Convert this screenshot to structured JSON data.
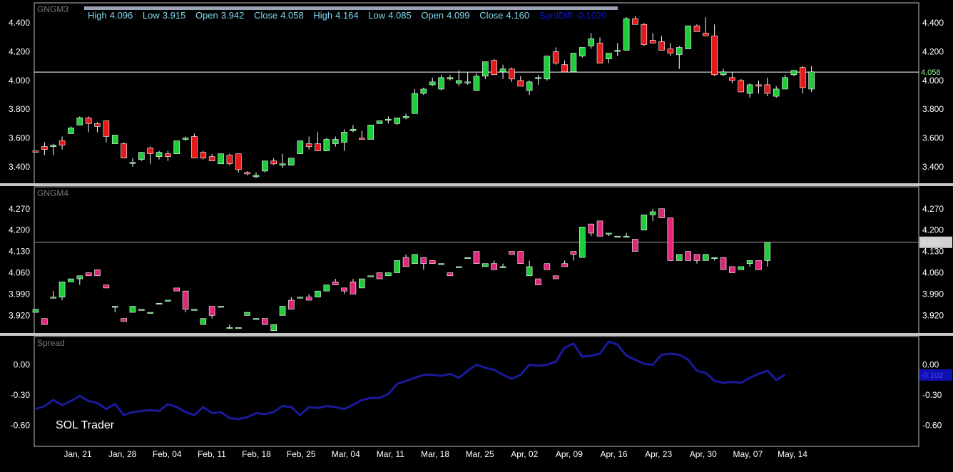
{
  "info_bar": {
    "high_label": "High",
    "high_value": "4.096",
    "low_label": "Low",
    "low_value": "3.915",
    "open_label": "Open",
    "open_value": "3.942",
    "close_label": "Close",
    "close_value": "4.058",
    "high2_label": "High",
    "high2_value": "4.164",
    "low2_label": "Low",
    "low2_value": "4.085",
    "open2_label": "Open",
    "open2_value": "4.099",
    "close2_label": "Close",
    "close2_value": "4.160",
    "spread_label": "SprdDiff",
    "spread_value": "-0.1020"
  },
  "brand": "SOL Trader",
  "colors": {
    "background": "#000000",
    "up": "#1fcc3a",
    "down_top": "#e41a1a",
    "down_bottom": "#e0287a",
    "spread_line": "#1a1a9c",
    "last_marker_top": "#9bf59b",
    "last_marker_mid": "#d0d0d0",
    "last_marker_spread": "#1010b0"
  },
  "chart_data": [
    {
      "type": "candlestick",
      "title": "GNGM3",
      "ylim": [
        3.28,
        4.54
      ],
      "y_ticks": [
        "4.400",
        "4.200",
        "4.000",
        "3.800",
        "3.600",
        "3.400"
      ],
      "last_value": "4.058",
      "x_ticks": [
        "Jan, 21",
        "Jan, 28",
        "Feb, 04",
        "Feb, 11",
        "Feb, 18",
        "Feb, 25",
        "Mar, 04",
        "Mar, 11",
        "Mar, 18",
        "Mar, 25",
        "Apr, 02",
        "Apr, 09",
        "Apr, 16",
        "Apr, 23",
        "Apr, 30",
        "May, 07",
        "May, 14"
      ],
      "candles": [
        [
          3.51,
          3.51,
          3.5,
          3.5
        ],
        [
          3.54,
          3.57,
          3.48,
          3.52
        ],
        [
          3.54,
          3.56,
          3.48,
          3.55
        ],
        [
          3.58,
          3.61,
          3.52,
          3.55
        ],
        [
          3.63,
          3.68,
          3.63,
          3.67
        ],
        [
          3.69,
          3.75,
          3.69,
          3.74
        ],
        [
          3.74,
          3.75,
          3.64,
          3.7
        ],
        [
          3.7,
          3.71,
          3.64,
          3.68
        ],
        [
          3.72,
          3.72,
          3.57,
          3.61
        ],
        [
          3.56,
          3.62,
          3.56,
          3.62
        ],
        [
          3.56,
          3.57,
          3.46,
          3.46
        ],
        [
          3.43,
          3.46,
          3.4,
          3.43
        ],
        [
          3.45,
          3.5,
          3.44,
          3.5
        ],
        [
          3.53,
          3.54,
          3.42,
          3.49
        ],
        [
          3.47,
          3.51,
          3.45,
          3.5
        ],
        [
          3.49,
          3.51,
          3.44,
          3.47
        ],
        [
          3.49,
          3.58,
          3.49,
          3.58
        ],
        [
          3.59,
          3.61,
          3.58,
          3.6
        ],
        [
          3.61,
          3.63,
          3.46,
          3.46
        ],
        [
          3.5,
          3.51,
          3.45,
          3.46
        ],
        [
          3.47,
          3.49,
          3.44,
          3.44
        ],
        [
          3.42,
          3.49,
          3.42,
          3.49
        ],
        [
          3.48,
          3.49,
          3.41,
          3.42
        ],
        [
          3.49,
          3.49,
          3.36,
          3.38
        ],
        [
          3.36,
          3.37,
          3.34,
          3.35
        ],
        [
          3.33,
          3.36,
          3.32,
          3.34
        ],
        [
          3.37,
          3.44,
          3.36,
          3.44
        ],
        [
          3.44,
          3.46,
          3.41,
          3.42
        ],
        [
          3.41,
          3.49,
          3.39,
          3.42
        ],
        [
          3.41,
          3.46,
          3.41,
          3.46
        ],
        [
          3.49,
          3.58,
          3.49,
          3.58
        ],
        [
          3.56,
          3.61,
          3.52,
          3.54
        ],
        [
          3.56,
          3.64,
          3.51,
          3.51
        ],
        [
          3.51,
          3.6,
          3.51,
          3.59
        ],
        [
          3.56,
          3.61,
          3.54,
          3.59
        ],
        [
          3.57,
          3.66,
          3.51,
          3.64
        ],
        [
          3.65,
          3.69,
          3.64,
          3.66
        ],
        [
          3.6,
          3.65,
          3.59,
          3.59
        ],
        [
          3.59,
          3.69,
          3.59,
          3.69
        ],
        [
          3.7,
          3.72,
          3.7,
          3.72
        ],
        [
          3.73,
          3.75,
          3.7,
          3.73
        ],
        [
          3.7,
          3.74,
          3.69,
          3.74
        ],
        [
          3.74,
          3.77,
          3.73,
          3.75
        ],
        [
          3.77,
          3.94,
          3.77,
          3.91
        ],
        [
          3.91,
          3.95,
          3.9,
          3.94
        ],
        [
          3.97,
          4.02,
          3.96,
          3.99
        ],
        [
          3.94,
          4.04,
          3.93,
          4.02
        ],
        [
          4.01,
          4.04,
          4.0,
          4.02
        ],
        [
          3.98,
          4.07,
          3.96,
          4.0
        ],
        [
          3.99,
          4.06,
          3.97,
          3.99
        ],
        [
          3.93,
          4.05,
          3.93,
          4.03
        ],
        [
          4.03,
          4.1,
          4.01,
          4.13
        ],
        [
          4.14,
          4.15,
          4.06,
          4.04
        ],
        [
          4.06,
          4.11,
          4.01,
          4.08
        ],
        [
          4.08,
          4.09,
          3.99,
          4.01
        ],
        [
          4.0,
          4.03,
          3.96,
          3.96
        ],
        [
          3.93,
          4.0,
          3.9,
          3.99
        ],
        [
          4.02,
          4.04,
          3.97,
          4.02
        ],
        [
          4.01,
          4.17,
          4.0,
          4.17
        ],
        [
          4.2,
          4.23,
          4.11,
          4.12
        ],
        [
          4.11,
          4.14,
          4.06,
          4.06
        ],
        [
          4.06,
          4.17,
          4.06,
          4.19
        ],
        [
          4.17,
          4.21,
          4.16,
          4.23
        ],
        [
          4.24,
          4.33,
          4.22,
          4.29
        ],
        [
          4.26,
          4.3,
          4.12,
          4.12
        ],
        [
          4.15,
          4.19,
          4.12,
          4.19
        ],
        [
          4.21,
          4.26,
          4.17,
          4.21
        ],
        [
          4.21,
          4.44,
          4.21,
          4.43
        ],
        [
          4.43,
          4.45,
          4.4,
          4.39
        ],
        [
          4.39,
          4.4,
          4.24,
          4.25
        ],
        [
          4.28,
          4.33,
          4.26,
          4.26
        ],
        [
          4.27,
          4.31,
          4.21,
          4.21
        ],
        [
          4.22,
          4.26,
          4.17,
          4.19
        ],
        [
          4.18,
          4.24,
          4.08,
          4.23
        ],
        [
          4.22,
          4.38,
          4.22,
          4.38
        ],
        [
          4.38,
          4.39,
          4.34,
          4.34
        ],
        [
          4.33,
          4.44,
          4.31,
          4.31
        ],
        [
          4.31,
          4.39,
          4.03,
          4.04
        ],
        [
          4.04,
          4.08,
          4.03,
          4.06
        ],
        [
          4.02,
          4.06,
          3.98,
          4.0
        ],
        [
          4.0,
          4.01,
          3.92,
          3.92
        ],
        [
          3.91,
          3.98,
          3.88,
          3.97
        ],
        [
          3.97,
          4.0,
          3.91,
          3.96
        ],
        [
          3.97,
          4.02,
          3.89,
          3.91
        ],
        [
          3.89,
          3.96,
          3.88,
          3.94
        ],
        [
          3.94,
          4.04,
          3.94,
          4.02
        ],
        [
          4.04,
          4.07,
          4.03,
          4.07
        ],
        [
          4.09,
          4.1,
          3.91,
          3.95
        ],
        [
          3.94,
          4.1,
          3.92,
          4.06
        ]
      ]
    },
    {
      "type": "candlestick",
      "title": "GNGM4",
      "ylim": [
        3.86,
        4.342
      ],
      "y_ticks": [
        "4.270",
        "4.200",
        "4.130",
        "4.060",
        "3.990",
        "3.920"
      ],
      "last_value": "4.160",
      "x_ticks": [
        "Jan, 21",
        "Jan, 28",
        "Feb, 04",
        "Feb, 11",
        "Feb, 18",
        "Feb, 25",
        "Mar, 04",
        "Mar, 11",
        "Mar, 18",
        "Mar, 25",
        "Apr, 02",
        "Apr, 09",
        "Apr, 16",
        "Apr, 23",
        "Apr, 30",
        "May, 07",
        "May, 14"
      ],
      "candles": [
        [
          3.93,
          3.94,
          3.93,
          3.94
        ],
        [
          3.91,
          3.91,
          3.89,
          3.89
        ],
        [
          3.98,
          4.0,
          3.98,
          3.98
        ],
        [
          3.98,
          3.99,
          3.97,
          4.03
        ],
        [
          4.03,
          4.04,
          4.03,
          4.04
        ],
        [
          4.04,
          4.05,
          4.02,
          4.05
        ],
        [
          4.06,
          4.06,
          4.05,
          4.05
        ],
        [
          4.07,
          4.07,
          4.05,
          4.05
        ],
        [
          4.02,
          4.02,
          4.01,
          4.01
        ],
        [
          3.95,
          3.95,
          3.93,
          3.95
        ],
        [
          3.91,
          3.91,
          3.9,
          3.9
        ],
        [
          3.93,
          3.93,
          3.93,
          3.95
        ],
        [
          3.94,
          3.94,
          3.94,
          3.94
        ],
        [
          3.93,
          3.93,
          3.93,
          3.93
        ],
        [
          3.96,
          3.96,
          3.96,
          3.96
        ],
        [
          3.97,
          3.97,
          3.97,
          3.97
        ],
        [
          4.01,
          4.01,
          4.0,
          4.0
        ],
        [
          4.0,
          4.0,
          3.93,
          3.94
        ],
        [
          3.94,
          3.94,
          3.94,
          3.94
        ],
        [
          3.89,
          3.89,
          3.89,
          3.91
        ],
        [
          3.95,
          3.95,
          3.91,
          3.92
        ],
        [
          3.95,
          3.95,
          3.95,
          3.95
        ],
        [
          3.88,
          3.89,
          3.88,
          3.88
        ],
        [
          3.88,
          3.88,
          3.88,
          3.88
        ],
        [
          3.92,
          3.92,
          3.92,
          3.93
        ],
        [
          3.91,
          3.91,
          3.91,
          3.91
        ],
        [
          3.91,
          3.91,
          3.89,
          3.89
        ],
        [
          3.87,
          3.88,
          3.87,
          3.89
        ],
        [
          3.92,
          3.95,
          3.94,
          3.95
        ],
        [
          3.97,
          3.98,
          3.94,
          3.94
        ],
        [
          3.98,
          3.98,
          3.98,
          3.98
        ],
        [
          3.98,
          3.99,
          3.97,
          3.97
        ],
        [
          3.98,
          4.0,
          3.98,
          4.0
        ],
        [
          4.0,
          4.02,
          4.0,
          4.02
        ],
        [
          4.03,
          4.04,
          4.02,
          4.02
        ],
        [
          4.01,
          4.01,
          3.99,
          4.0
        ],
        [
          4.03,
          4.04,
          3.99,
          3.99
        ],
        [
          4.01,
          4.04,
          4.01,
          4.04
        ],
        [
          4.05,
          4.05,
          4.05,
          4.05
        ],
        [
          4.06,
          4.06,
          4.05,
          4.04
        ],
        [
          4.05,
          4.06,
          4.05,
          4.06
        ],
        [
          4.06,
          4.1,
          4.06,
          4.1
        ],
        [
          4.11,
          4.12,
          4.08,
          4.08
        ],
        [
          4.09,
          4.12,
          4.09,
          4.12
        ],
        [
          4.11,
          4.11,
          4.07,
          4.09
        ],
        [
          4.1,
          4.1,
          4.09,
          4.09
        ],
        [
          4.09,
          4.09,
          4.09,
          4.09
        ],
        [
          4.06,
          4.06,
          4.05,
          4.05
        ],
        [
          4.08,
          4.08,
          4.08,
          4.08
        ],
        [
          4.11,
          4.11,
          4.11,
          4.11
        ],
        [
          4.13,
          4.13,
          4.09,
          4.09
        ],
        [
          4.08,
          4.09,
          4.08,
          4.09
        ],
        [
          4.09,
          4.1,
          4.07,
          4.07
        ],
        [
          4.08,
          4.09,
          4.08,
          4.08
        ],
        [
          4.13,
          4.13,
          4.12,
          4.12
        ],
        [
          4.13,
          4.13,
          4.09,
          4.09
        ],
        [
          4.05,
          4.1,
          4.05,
          4.08
        ],
        [
          4.04,
          4.04,
          4.02,
          4.02
        ],
        [
          4.09,
          4.09,
          4.07,
          4.07
        ],
        [
          4.05,
          4.05,
          4.04,
          4.04
        ],
        [
          4.09,
          4.1,
          4.08,
          4.08
        ],
        [
          4.13,
          4.13,
          4.1,
          4.12
        ],
        [
          4.11,
          4.21,
          4.11,
          4.21
        ],
        [
          4.22,
          4.22,
          4.18,
          4.19
        ],
        [
          4.23,
          4.23,
          4.18,
          4.18
        ],
        [
          4.19,
          4.19,
          4.18,
          4.19
        ],
        [
          4.18,
          4.18,
          4.18,
          4.18
        ],
        [
          4.18,
          4.19,
          4.18,
          4.18
        ],
        [
          4.17,
          4.17,
          4.13,
          4.13
        ],
        [
          4.2,
          4.25,
          4.2,
          4.25
        ],
        [
          4.25,
          4.27,
          4.23,
          4.26
        ],
        [
          4.27,
          4.27,
          4.24,
          4.24
        ],
        [
          4.24,
          4.24,
          4.1,
          4.1
        ],
        [
          4.1,
          4.12,
          4.1,
          4.12
        ],
        [
          4.13,
          4.13,
          4.1,
          4.1
        ],
        [
          4.12,
          4.12,
          4.09,
          4.1
        ],
        [
          4.1,
          4.12,
          4.1,
          4.12
        ],
        [
          4.11,
          4.11,
          4.1,
          4.11
        ],
        [
          4.11,
          4.11,
          4.07,
          4.07
        ],
        [
          4.08,
          4.08,
          4.06,
          4.06
        ],
        [
          4.07,
          4.08,
          4.07,
          4.08
        ],
        [
          4.09,
          4.1,
          4.08,
          4.1
        ],
        [
          4.1,
          4.1,
          4.07,
          4.07
        ],
        [
          4.1,
          4.16,
          4.08,
          4.16
        ]
      ]
    },
    {
      "type": "line",
      "title": "Spread",
      "ylim": [
        -0.81,
        0.28
      ],
      "y_ticks": [
        "0.00",
        "-0.30",
        "-0.60"
      ],
      "last_value": "-0.102",
      "x_ticks": [
        "Jan, 21",
        "Jan, 28",
        "Feb, 04",
        "Feb, 11",
        "Feb, 18",
        "Feb, 25",
        "Mar, 04",
        "Mar, 11",
        "Mar, 18",
        "Mar, 25",
        "Apr, 02",
        "Apr, 09",
        "Apr, 16",
        "Apr, 23",
        "Apr, 30",
        "May, 07",
        "May, 14"
      ],
      "values": [
        -0.44,
        -0.41,
        -0.35,
        -0.4,
        -0.36,
        -0.31,
        -0.36,
        -0.38,
        -0.44,
        -0.39,
        -0.5,
        -0.47,
        -0.46,
        -0.45,
        -0.46,
        -0.39,
        -0.42,
        -0.47,
        -0.5,
        -0.42,
        -0.48,
        -0.47,
        -0.53,
        -0.54,
        -0.52,
        -0.48,
        -0.49,
        -0.47,
        -0.41,
        -0.42,
        -0.5,
        -0.42,
        -0.43,
        -0.41,
        -0.42,
        -0.44,
        -0.4,
        -0.35,
        -0.33,
        -0.33,
        -0.29,
        -0.19,
        -0.16,
        -0.13,
        -0.1,
        -0.1,
        -0.11,
        -0.09,
        -0.13,
        -0.06,
        0.0,
        -0.03,
        -0.05,
        -0.1,
        -0.14,
        -0.1,
        0.0,
        -0.01,
        0.0,
        0.03,
        0.17,
        0.21,
        0.08,
        0.09,
        0.11,
        0.23,
        0.2,
        0.09,
        0.05,
        0.01,
        0.0,
        0.1,
        0.11,
        0.1,
        0.05,
        -0.06,
        -0.08,
        -0.16,
        -0.18,
        -0.17,
        -0.18,
        -0.13,
        -0.09,
        -0.06,
        -0.15,
        -0.1
      ]
    }
  ]
}
